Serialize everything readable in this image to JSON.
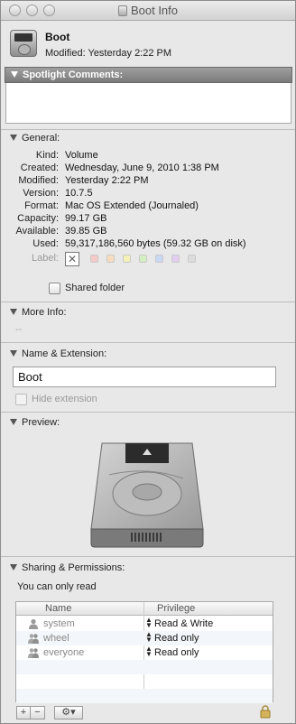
{
  "window": {
    "title": "Boot Info"
  },
  "header": {
    "name": "Boot",
    "modified": "Modified: Yesterday 2:22 PM"
  },
  "spotlight": {
    "title": "Spotlight Comments:",
    "comment": ""
  },
  "general": {
    "title": "General:",
    "rows": [
      {
        "label": "Kind:",
        "value": "Volume"
      },
      {
        "label": "Created:",
        "value": "Wednesday, June 9, 2010 1:38 PM"
      },
      {
        "label": "Modified:",
        "value": "Yesterday 2:22 PM"
      },
      {
        "label": "Version:",
        "value": "10.7.5"
      },
      {
        "label": "Format:",
        "value": "Mac OS Extended (Journaled)"
      },
      {
        "label": "Capacity:",
        "value": "99.17 GB"
      },
      {
        "label": "Available:",
        "value": "39.85 GB"
      },
      {
        "label": "Used:",
        "value": "59,317,186,560 bytes (59.32 GB on disk)"
      }
    ],
    "label_title": "Label:",
    "label_colors": [
      "#f6c9c9",
      "#f7dcbf",
      "#f6f1b8",
      "#d4efc2",
      "#c9d9f4",
      "#e2cdef",
      "#dcdcdc"
    ],
    "shared_folder": "Shared folder"
  },
  "more_info": {
    "title": "More Info:",
    "value": "--"
  },
  "name_ext": {
    "title": "Name & Extension:",
    "name": "Boot",
    "hide_extension": "Hide extension"
  },
  "preview": {
    "title": "Preview:"
  },
  "sharing": {
    "title": "Sharing & Permissions:",
    "status": "You can only read",
    "columns": [
      "Name",
      "Privilege"
    ],
    "rows": [
      {
        "name": "system",
        "privilege": "Read & Write",
        "icon": "user-icon"
      },
      {
        "name": "wheel",
        "privilege": "Read only",
        "icon": "group-icon"
      },
      {
        "name": "everyone",
        "privilege": "Read only",
        "icon": "group-icon"
      }
    ],
    "buttons": {
      "add": "+",
      "remove": "−",
      "action": "⚙▾"
    }
  }
}
